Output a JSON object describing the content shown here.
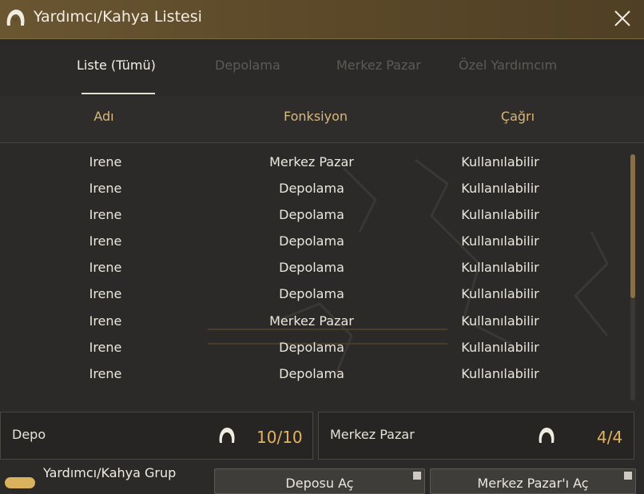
{
  "window": {
    "title": "Yardımcı/Kahya Listesi"
  },
  "tabs": [
    {
      "label": "Liste (Tümü)",
      "active": true
    },
    {
      "label": "Depolama",
      "active": false
    },
    {
      "label": "Merkez Pazar",
      "active": false
    },
    {
      "label": "Özel Yardımcım",
      "active": false
    }
  ],
  "columns": {
    "name": "Adı",
    "function": "Fonksiyon",
    "call": "Çağrı"
  },
  "rows": [
    {
      "name": "Irene",
      "function": "Merkez Pazar",
      "call": "Kullanılabilir"
    },
    {
      "name": "Irene",
      "function": "Depolama",
      "call": "Kullanılabilir"
    },
    {
      "name": "Irene",
      "function": "Depolama",
      "call": "Kullanılabilir"
    },
    {
      "name": "Irene",
      "function": "Depolama",
      "call": "Kullanılabilir"
    },
    {
      "name": "Irene",
      "function": "Depolama",
      "call": "Kullanılabilir"
    },
    {
      "name": "Irene",
      "function": "Depolama",
      "call": "Kullanılabilir"
    },
    {
      "name": "Irene",
      "function": "Merkez Pazar",
      "call": "Kullanılabilir"
    },
    {
      "name": "Irene",
      "function": "Depolama",
      "call": "Kullanılabilir"
    },
    {
      "name": "Irene",
      "function": "Depolama",
      "call": "Kullanılabilir"
    }
  ],
  "panels": {
    "depo": {
      "label": "Depo",
      "count": "10/10"
    },
    "market": {
      "label": "Merkez Pazar",
      "count": "4/4"
    }
  },
  "group": {
    "label": "Yardımcı/Kahya Grup"
  },
  "buttons": {
    "storage": "Deposu Aç",
    "market": "Merkez Pazar'ı Aç"
  },
  "colors": {
    "accent": "#e6b35a",
    "header_gold": "#d9b77a",
    "titlebar": "#5e4b2a"
  },
  "icons": {
    "title": "helper-hair-icon",
    "close": "close-icon"
  }
}
